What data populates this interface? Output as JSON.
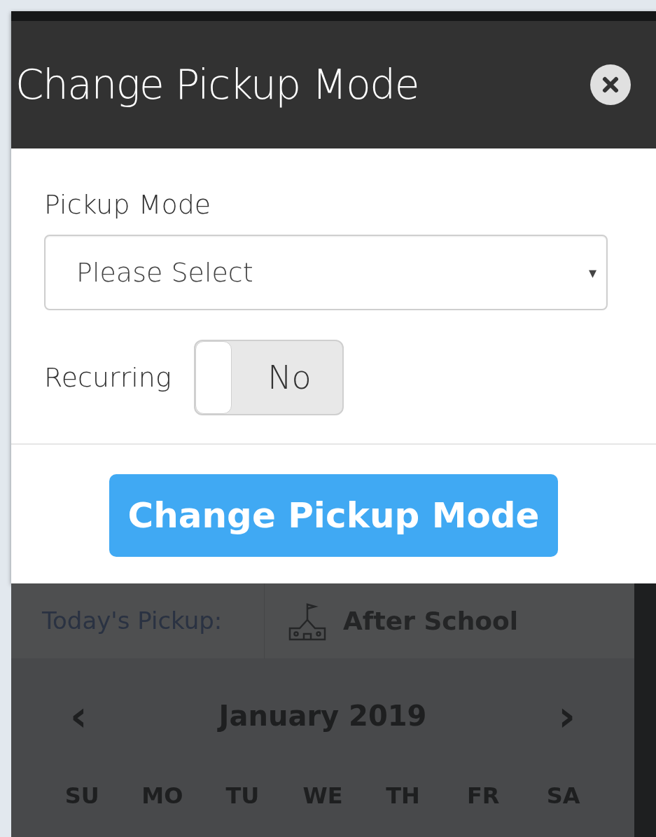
{
  "modal": {
    "title": "Change Pickup Mode",
    "field": {
      "label": "Pickup Mode",
      "value": "Please Select",
      "caret": "▾"
    },
    "recurring": {
      "label": "Recurring",
      "on": false,
      "state_text": "No"
    },
    "submit": "Change Pickup Mode"
  },
  "background": {
    "todays_pickup": {
      "label": "Today's Pickup:",
      "value": "After School"
    },
    "calendar": {
      "prev": "‹",
      "month": "January 2019",
      "next": "›",
      "weekdays": [
        "SU",
        "MO",
        "TU",
        "WE",
        "TH",
        "FR",
        "SA"
      ]
    }
  }
}
